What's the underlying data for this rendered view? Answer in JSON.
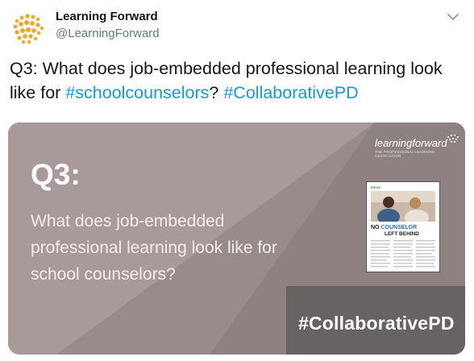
{
  "account": {
    "name": "Learning Forward",
    "handle": "@LearningForward"
  },
  "tweet": {
    "line1": "Q3: What does job-embedded professional learning look",
    "line2_prefix": "like for ",
    "hashtag1": "#schoolcounselors",
    "separator": "? ",
    "hashtag2": "#CollaborativePD"
  },
  "card": {
    "question_label": "Q3:",
    "question_text": "What does job-embedded professional learning look like for school counselors?",
    "hashtag": "#CollaborativePD",
    "logo_word": "learningforward",
    "logo_tagline": "THE PROFESSIONAL LEARNING ASSOCIATION",
    "magazine": {
      "kicker": "IDEAS",
      "title_no": "NO ",
      "title_counselor": "COUNSELOR",
      "title_rest": "LEFT BEHIND"
    }
  },
  "colors": {
    "link": "#1b95e0",
    "card_background": "#a89a9a",
    "card_dark_band": "#696262",
    "logo_orange": "#f5a623"
  },
  "icons": {
    "avatar": "learning-forward-dots-logo",
    "menu": "chevron-down-icon"
  }
}
